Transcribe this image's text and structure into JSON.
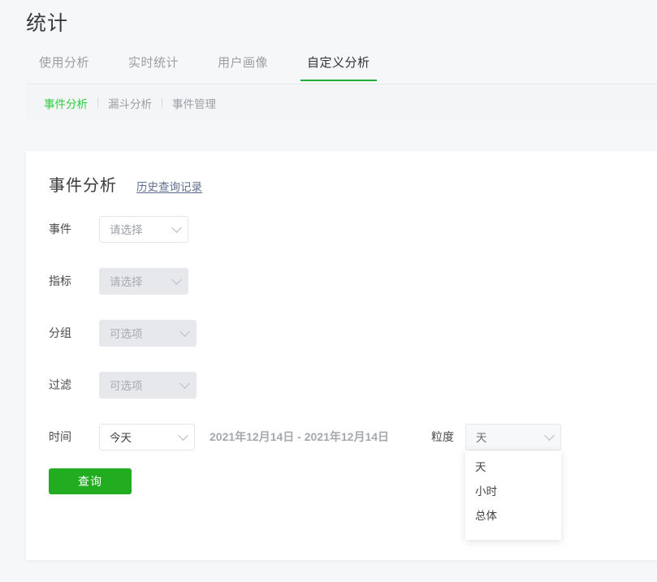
{
  "page": {
    "title": "统计",
    "accent_color": "#23ac38",
    "link_color": "#5f6e8e",
    "button_color": "#22ac1f",
    "subnav_active_color": "#2ecc40"
  },
  "tabs": [
    {
      "label": "使用分析",
      "active": false
    },
    {
      "label": "实时统计",
      "active": false
    },
    {
      "label": "用户画像",
      "active": false
    },
    {
      "label": "自定义分析",
      "active": true
    }
  ],
  "subnav": [
    {
      "label": "事件分析",
      "active": true
    },
    {
      "label": "漏斗分析",
      "active": false
    },
    {
      "label": "事件管理",
      "active": false
    }
  ],
  "card": {
    "title": "事件分析",
    "history_link": "历史查询记录"
  },
  "form": {
    "rows": [
      {
        "label": "事件",
        "value": "请选择",
        "state": "placeholder"
      },
      {
        "label": "指标",
        "value": "请选择",
        "state": "disabled"
      },
      {
        "label": "分组",
        "value": "可选项",
        "state": "disabled"
      },
      {
        "label": "过滤",
        "value": "可选项",
        "state": "disabled"
      }
    ],
    "time": {
      "label": "时间",
      "value": "今天",
      "date_range": "2021年12月14日 - 2021年12月14日"
    },
    "granularity": {
      "label": "粒度",
      "value": "天",
      "open": true,
      "options": [
        "天",
        "小时",
        "总体"
      ]
    },
    "submit_label": "查询"
  },
  "icons": {
    "caret": "chevron-down-icon"
  }
}
